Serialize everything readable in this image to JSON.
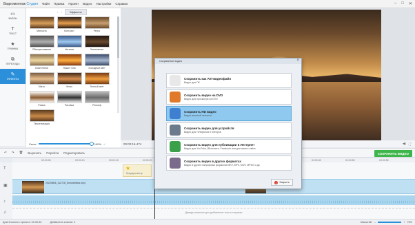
{
  "app": {
    "logo_prefix": "Видеомонтаж",
    "logo_brand": "Студия"
  },
  "menu": [
    "Файл",
    "Правка",
    "Проект",
    "Видео",
    "Настройки",
    "Справка"
  ],
  "sidebar": [
    {
      "icon": "folder-icon",
      "label": "ФАЙЛЫ"
    },
    {
      "icon": "text-icon",
      "label": "ТЕКСТ"
    },
    {
      "icon": "star-icon",
      "label": "ГРАФИКА"
    },
    {
      "icon": "transitions-icon",
      "label": "ПЕРЕХОДЫ"
    },
    {
      "icon": "magic-icon",
      "label": "ЭФФЕКТЫ"
    }
  ],
  "effects": {
    "tab": "Эффекты",
    "items": [
      {
        "label": "Мягкость"
      },
      {
        "label": "Контраст"
      },
      {
        "label": "Ретро"
      },
      {
        "label": "Обесцвечивание"
      },
      {
        "label": "Негатив"
      },
      {
        "label": "Затемнение"
      },
      {
        "label": "Осветление"
      },
      {
        "label": "Яркие тона"
      },
      {
        "label": "Холодный свет"
      },
      {
        "label": "Мягко"
      },
      {
        "label": "Четко"
      },
      {
        "label": "Теплый свет"
      },
      {
        "label": "Рамка"
      },
      {
        "label": "Рисовка"
      },
      {
        "label": "Рельеф"
      },
      {
        "label": "Пикселизация"
      }
    ],
    "strength_label": "Сила:",
    "strength_value": "100%"
  },
  "preview": {
    "time": "00:00:16.474"
  },
  "toolbar": {
    "items": [
      "Вырезать",
      "Перейти",
      "Редактировать"
    ],
    "save_button": "СОХРАНИТЬ ВИДЕО"
  },
  "ruler": [
    "00:00:05",
    "00:00:10",
    "00:00:15",
    "00:00:20",
    "00:00:25",
    "00:00:30",
    "00:00:35",
    "00:00:40",
    "00:00:45",
    "00:00:50",
    "00:00:55"
  ],
  "timeline": {
    "title_clip": "Предпросмотр",
    "video_clip": "20220806_112718_Smoothlines.mp4",
    "music_hint": "Дважды кликните для добавления текста и музыки"
  },
  "status": {
    "duration": "Длительность проекта: 00:00:52",
    "added": "Добавлено клипов: 2",
    "zoom_label": "Масштаб:",
    "zoom_value": "75%"
  },
  "dialog": {
    "title": "Сохранение видео",
    "options": [
      {
        "title": "Сохранить как AVI-видеофайл",
        "sub": "Видео для ПК",
        "icon_color": "#e8e8e8",
        "selected": false
      },
      {
        "title": "Сохранить видео на DVD",
        "sub": "Видео для просмотра на DVD",
        "icon_color": "#e07a2a",
        "selected": false
      },
      {
        "title": "Сохранить HD видео",
        "sub": "Видео высокой четкости",
        "icon_color": "#3f7fd0",
        "selected": true
      },
      {
        "title": "Сохранить видео для устройств",
        "sub": "Видео для телефонов и плееров",
        "icon_color": "#6b7b8c",
        "selected": false
      },
      {
        "title": "Сохранить видео для публикации в Интернет",
        "sub": "Видео для YouTube, ВКонтакте, Facebook или для своего сайта",
        "icon_color": "#3ba04a",
        "selected": false
      },
      {
        "title": "Сохранить видео в других форматах",
        "sub": "Видео в других популярных форматах MKV, MP4, MOV, MPEG и др.",
        "icon_color": "#7a6a8c",
        "selected": false
      }
    ],
    "cancel": "Закрыть"
  }
}
